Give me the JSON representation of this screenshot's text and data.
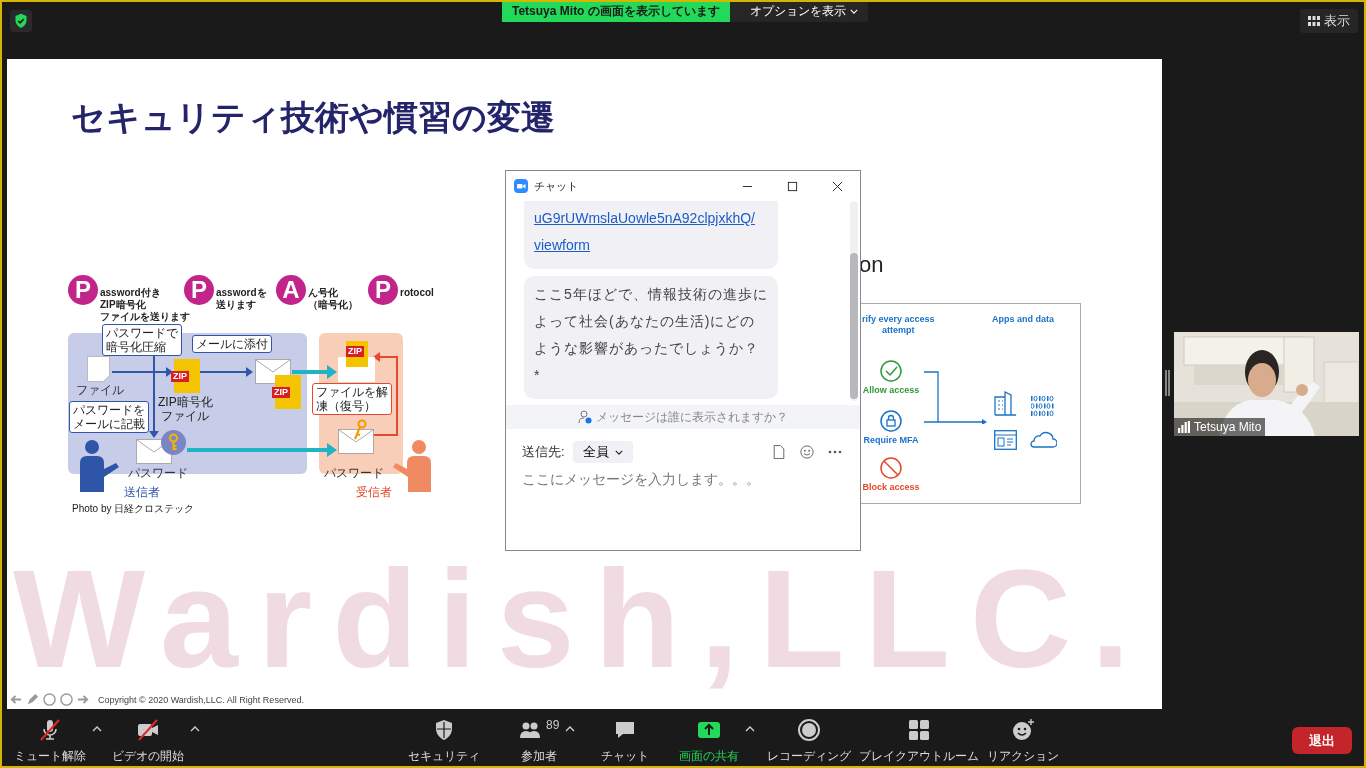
{
  "top_bar": {
    "banner": "Tetsuya Mito の画面を表示しています",
    "options": "オプションを表示",
    "view_button": "表示"
  },
  "slide": {
    "title": "セキュリティ技術や慣習の変遷",
    "headings": [
      {
        "letter": "P",
        "lines": [
          "assword付き",
          "ZIP暗号化",
          "ファイルを送ります"
        ]
      },
      {
        "letter": "P",
        "lines": [
          "asswordを",
          "送ります"
        ]
      },
      {
        "letter": "A",
        "lines": [
          "ん号化",
          "（暗号化）"
        ]
      },
      {
        "letter": "P",
        "lines": [
          "rotocol"
        ]
      }
    ],
    "bubbles": [
      [
        "パスワードで",
        "暗号化圧縮"
      ],
      [
        "メールに添付"
      ],
      [
        "パスワードを",
        "メールに記載"
      ],
      [
        "ファイルを解",
        "凍（復号）"
      ]
    ],
    "zip_tags": [
      "ZIP",
      "ZIP",
      "ZIP"
    ],
    "labels": {
      "file": "ファイル",
      "zip_file": [
        "ZIP暗号化",
        "ファイル"
      ],
      "password_sent": "パスワード",
      "password_received": "パスワード",
      "sender": "送信者",
      "receiver": "受信者"
    },
    "credit": "Photo by 日経クロステック",
    "partial_heading": "on",
    "right_diagram": {
      "verify": [
        "rify every access",
        "attempt"
      ],
      "apps": "Apps and data",
      "outcomes": [
        {
          "kind": "allow",
          "label": "Allow access"
        },
        {
          "kind": "mfa",
          "label": "Require MFA"
        },
        {
          "kind": "block",
          "label": "Block access"
        }
      ]
    },
    "watermark": "Wardish,LLC.",
    "copyright": "Copyright © 2020 Wardish,LLC. All Right Reserved."
  },
  "chat": {
    "title": "チャット",
    "messages": [
      {
        "kind": "link",
        "text": "uG9rUWmslaUowle5nA92clpjxkhQ/\nviewform"
      },
      {
        "kind": "text",
        "text": "ここ5年ほどで、情報技術の進歩によって社会(あなたの生活)にどのような影響があったでしょうか？\n*"
      }
    ],
    "visibility_note": "メッセージは誰に表示されますか？",
    "recipient_label": "送信先:",
    "recipient": "全員",
    "placeholder": "ここにメッセージを入力します。。。"
  },
  "video": {
    "name": "Tetsuya Mito"
  },
  "toolbar": {
    "items": [
      {
        "kind": "mic",
        "label": "ミュート解除",
        "crossed": true,
        "caret": true,
        "highlighted": false
      },
      {
        "kind": "camera",
        "label": "ビデオの開始",
        "crossed": true,
        "caret": true,
        "highlighted": false
      },
      {
        "kind": "shield",
        "label": "セキュリティ",
        "crossed": false,
        "caret": false,
        "highlighted": false
      },
      {
        "kind": "people",
        "label": "参加者",
        "count": "89",
        "crossed": false,
        "caret": true,
        "highlighted": false
      },
      {
        "kind": "chat",
        "label": "チャット",
        "crossed": false,
        "caret": false,
        "highlighted": false
      },
      {
        "kind": "share",
        "label": "画面の共有",
        "crossed": false,
        "caret": true,
        "highlighted": true
      },
      {
        "kind": "record",
        "label": "レコーディング",
        "crossed": false,
        "caret": false,
        "highlighted": false
      },
      {
        "kind": "rooms",
        "label": "ブレイクアウトルーム",
        "crossed": false,
        "caret": false,
        "highlighted": false
      },
      {
        "kind": "reaction",
        "label": "リアクション",
        "crossed": false,
        "caret": false,
        "highlighted": false
      }
    ],
    "leave": "退出"
  }
}
